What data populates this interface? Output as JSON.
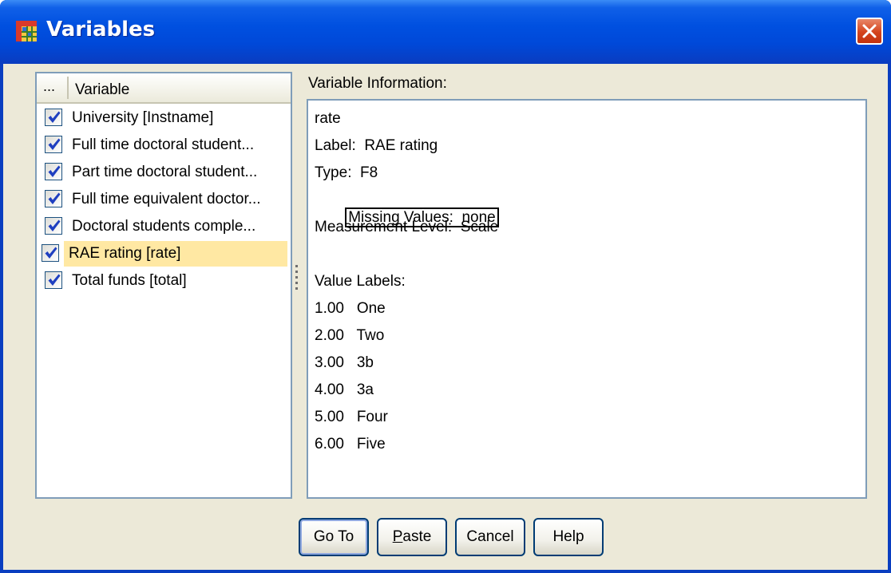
{
  "window": {
    "title": "Variables",
    "icon": "spss-data-grid-icon",
    "close_icon": "close-icon"
  },
  "variable_list": {
    "header_dots": "...",
    "header_label": "Variable",
    "items": [
      {
        "label": "University [Instname]",
        "checked": true,
        "selected": false
      },
      {
        "label": "Full time doctoral student...",
        "checked": true,
        "selected": false
      },
      {
        "label": "Part time doctoral student...",
        "checked": true,
        "selected": false
      },
      {
        "label": "Full time equivalent doctor...",
        "checked": true,
        "selected": false
      },
      {
        "label": "Doctoral students comple...",
        "checked": true,
        "selected": false
      },
      {
        "label": "RAE rating [rate]",
        "checked": true,
        "selected": true
      },
      {
        "label": "Total funds [total]",
        "checked": true,
        "selected": false
      }
    ]
  },
  "info": {
    "heading": "Variable Information:",
    "name": "rate",
    "label": "Label:  RAE rating",
    "type": "Type:  F8",
    "missing": "Missing Values:  none",
    "measurement": "Measurement Level:  Scale",
    "value_labels_heading": "Value Labels:",
    "value_labels": [
      "1.00   One",
      "2.00   Two",
      "3.00   3b",
      "4.00   3a",
      "5.00   Four",
      "6.00   Five"
    ]
  },
  "buttons": {
    "goto": "Go To",
    "paste_first": "P",
    "paste_rest": "aste",
    "cancel": "Cancel",
    "help": "Help"
  },
  "colors": {
    "title_bar": "#0054e3",
    "selection": "#ffe8a3",
    "dialog_bg": "#ece9d8",
    "panel_border": "#7f9db9"
  }
}
